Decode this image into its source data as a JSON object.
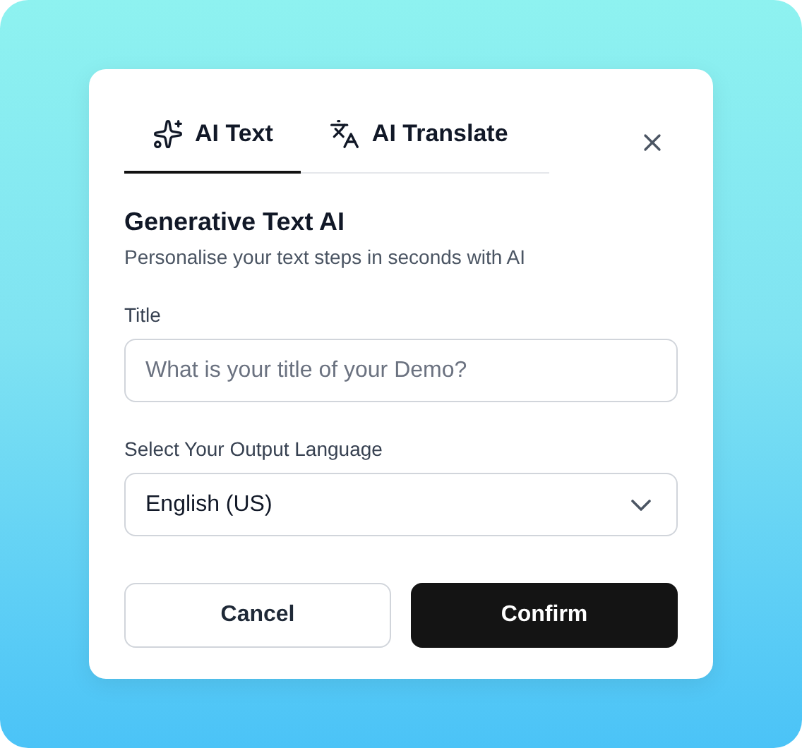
{
  "tabs": [
    {
      "label": "AI Text",
      "selected": true
    },
    {
      "label": "AI Translate",
      "selected": false
    }
  ],
  "heading": "Generative Text AI",
  "subtitle": "Personalise your text steps in seconds with AI",
  "title_field": {
    "label": "Title",
    "placeholder": "What is your title of your Demo?"
  },
  "language_field": {
    "label": "Select Your Output Language",
    "value": "English (US)"
  },
  "buttons": [
    {
      "label": "Cancel",
      "kind": "secondary"
    },
    {
      "label": "Confirm",
      "kind": "primary"
    }
  ]
}
